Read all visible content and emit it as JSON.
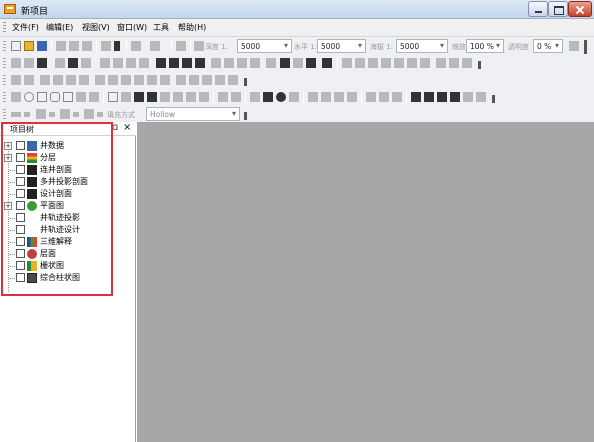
{
  "window": {
    "title": "新项目"
  },
  "menubar": {
    "items": [
      "文件(F)",
      "编辑(E)",
      "视图(V)",
      "窗口(W)",
      "工具",
      "帮助(H)"
    ]
  },
  "toolbar": {
    "depth_label": "深度 1:",
    "depth_value": "5000",
    "horizontal_label": "水平 1:",
    "horizontal_value": "5000",
    "elevation_label": "海拔 1:",
    "elevation_value": "5000",
    "zoom_label": "缩放",
    "zoom_value": "100 %",
    "transparency_label": "透明度",
    "transparency_value": "0 %",
    "fill_mode_label": "填充方式",
    "fill_mode_value": "Hollow"
  },
  "panel": {
    "title": "项目树",
    "pin_glyph": "ᗡ",
    "close_glyph": "×",
    "items": [
      {
        "label": "井数据",
        "icon": "well-data-icon",
        "expandable": true
      },
      {
        "label": "分层",
        "icon": "layers-icon",
        "expandable": true
      },
      {
        "label": "连井剖面",
        "icon": "well-section-icon",
        "expandable": false
      },
      {
        "label": "多井投影剖面",
        "icon": "projection-section-icon",
        "expandable": false
      },
      {
        "label": "设计剖面",
        "icon": "design-section-icon",
        "expandable": false
      },
      {
        "label": "平面图",
        "icon": "plan-map-icon",
        "expandable": true
      },
      {
        "label": "井轨迹投影",
        "icon": "",
        "expandable": false
      },
      {
        "label": "井轨迹设计",
        "icon": "",
        "expandable": false
      },
      {
        "label": "三维解释",
        "icon": "3d-interpret-icon",
        "expandable": false
      },
      {
        "label": "层面",
        "icon": "surface-icon",
        "expandable": false
      },
      {
        "label": "栅状图",
        "icon": "fence-diagram-icon",
        "expandable": false
      },
      {
        "label": "综合柱状图",
        "icon": "composite-column-icon",
        "expandable": false
      }
    ]
  },
  "colors": {
    "workspace": "#a7a7a7",
    "highlight": "#e0303a",
    "accent_blue": "#3a66b0"
  }
}
